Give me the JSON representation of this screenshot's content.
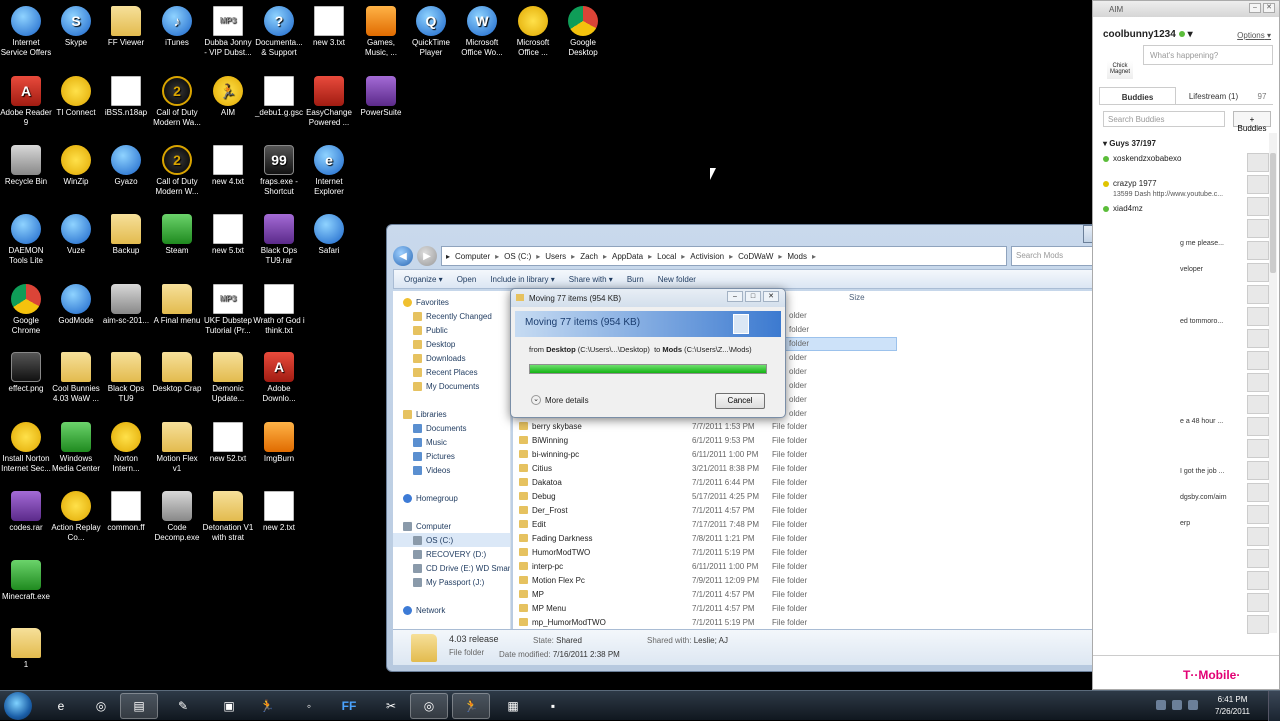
{
  "desktop": {
    "icons": [
      {
        "label": "Internet Service Offers",
        "icon": "globe-icon",
        "style": "blue"
      },
      {
        "label": "Skype",
        "icon": "skype-icon",
        "style": "blue",
        "glyph": "S"
      },
      {
        "label": "FF Viewer",
        "icon": "folder-icon",
        "style": "folder"
      },
      {
        "label": "iTunes",
        "icon": "itunes-icon",
        "style": "blue",
        "glyph": "♪"
      },
      {
        "label": "Dubba Jonny - VIP Dubst...",
        "icon": "mp3-icon",
        "style": "doc",
        "glyph": "MP3"
      },
      {
        "label": "Documenta... & Support",
        "icon": "help-icon",
        "style": "blue",
        "glyph": "?"
      },
      {
        "label": "new 3.txt",
        "icon": "text-file-icon",
        "style": "doc"
      },
      {
        "label": "Games, Music, ...",
        "icon": "games-icon",
        "style": "orange"
      },
      {
        "label": "QuickTime Player",
        "icon": "quicktime-icon",
        "style": "blue",
        "glyph": "Q"
      },
      {
        "label": "Microsoft Office Wo...",
        "icon": "word-icon",
        "style": "blue",
        "glyph": "W"
      },
      {
        "label": "Microsoft Office ...",
        "icon": "office-icon",
        "style": "yellow"
      },
      {
        "label": "Google Desktop",
        "icon": "google-desktop-icon",
        "style": "chrome"
      },
      {
        "label": "Adobe Reader 9",
        "icon": "adobe-reader-icon",
        "style": "red",
        "glyph": "A"
      },
      {
        "label": "TI Connect",
        "icon": "ti-connect-icon",
        "style": "yellow"
      },
      {
        "label": "iBSS.n18ap",
        "icon": "file-icon",
        "style": "doc"
      },
      {
        "label": "Call of Duty Modern Wa...",
        "icon": "cod-icon",
        "style": "cod",
        "glyph": "2"
      },
      {
        "label": "AIM",
        "icon": "aim-icon",
        "style": "yellow",
        "glyph": "🏃"
      },
      {
        "label": "_debu1.g.gsc",
        "icon": "file-icon",
        "style": "doc"
      },
      {
        "label": "EasyChange Powered ...",
        "icon": "easychange-icon",
        "style": "red"
      },
      {
        "label": "PowerSuite",
        "icon": "powersuite-icon",
        "style": "purple"
      },
      {
        "label": "Recycle Bin",
        "icon": "recycle-bin-icon",
        "style": "gray"
      },
      {
        "label": "WinZip",
        "icon": "winzip-icon",
        "style": "yellow"
      },
      {
        "label": "Gyazo",
        "icon": "gyazo-icon",
        "style": "blue"
      },
      {
        "label": "Call of Duty Modern W...",
        "icon": "cod-icon",
        "style": "cod",
        "glyph": "2"
      },
      {
        "label": "new 4.txt",
        "icon": "text-file-icon",
        "style": "doc"
      },
      {
        "label": "fraps.exe - Shortcut",
        "icon": "fraps-icon",
        "style": "dark",
        "glyph": "99"
      },
      {
        "label": "Internet Explorer",
        "icon": "ie-icon",
        "style": "blue",
        "glyph": "e"
      },
      {
        "label": "DAEMON Tools Lite",
        "icon": "daemon-tools-icon",
        "style": "blue"
      },
      {
        "label": "Vuze",
        "icon": "vuze-icon",
        "style": "blue"
      },
      {
        "label": "Backup",
        "icon": "folder-icon",
        "style": "folder"
      },
      {
        "label": "Steam",
        "icon": "steam-icon",
        "style": "green"
      },
      {
        "label": "new 5.txt",
        "icon": "text-file-icon",
        "style": "doc"
      },
      {
        "label": "Black Ops TU9.rar",
        "icon": "rar-icon",
        "style": "purple"
      },
      {
        "label": "Safari",
        "icon": "safari-icon",
        "style": "blue"
      },
      {
        "label": "Google Chrome",
        "icon": "chrome-icon",
        "style": "chrome"
      },
      {
        "label": "GodMode",
        "icon": "godmode-icon",
        "style": "blue"
      },
      {
        "label": "aim-sc-201...",
        "icon": "image-file-icon",
        "style": "gray"
      },
      {
        "label": "A Final menu",
        "icon": "folder-icon",
        "style": "folder"
      },
      {
        "label": "UKF Dubstep Tutorial (Pr...",
        "icon": "mp3-icon",
        "style": "doc",
        "glyph": "MP3"
      },
      {
        "label": "Wrath of God i think.txt",
        "icon": "text-file-icon",
        "style": "doc"
      },
      {
        "label": "effect.png",
        "icon": "image-file-icon",
        "style": "dark"
      },
      {
        "label": "Cool Bunnies 4.03 WaW ...",
        "icon": "folder-icon",
        "style": "folder"
      },
      {
        "label": "Black Ops TU9",
        "icon": "folder-icon",
        "style": "folder"
      },
      {
        "label": "Desktop Crap",
        "icon": "folder-icon",
        "style": "folder"
      },
      {
        "label": "Demonic Update...",
        "icon": "folder-icon",
        "style": "folder"
      },
      {
        "label": "Adobe Downlo...",
        "icon": "adobe-icon",
        "style": "red",
        "glyph": "A"
      },
      {
        "label": "Install Norton Internet Sec...",
        "icon": "norton-icon",
        "style": "yellow"
      },
      {
        "label": "Windows Media Center",
        "icon": "media-center-icon",
        "style": "green"
      },
      {
        "label": "Norton Intern...",
        "icon": "norton-icon",
        "style": "yellow"
      },
      {
        "label": "Motion Flex v1",
        "icon": "folder-icon",
        "style": "folder"
      },
      {
        "label": "new 52.txt",
        "icon": "text-file-icon",
        "style": "doc"
      },
      {
        "label": "ImgBurn",
        "icon": "imgburn-icon",
        "style": "orange"
      },
      {
        "label": "codes.rar",
        "icon": "rar-icon",
        "style": "purple"
      },
      {
        "label": "Action Replay Co...",
        "icon": "action-replay-icon",
        "style": "yellow"
      },
      {
        "label": "common.ff",
        "icon": "file-icon",
        "style": "doc"
      },
      {
        "label": "Code Decomp.exe",
        "icon": "exe-icon",
        "style": "gray"
      },
      {
        "label": "Detonation V1 with strat",
        "icon": "folder-icon",
        "style": "folder"
      },
      {
        "label": "new 2.txt",
        "icon": "text-file-icon",
        "style": "doc"
      },
      {
        "label": "Minecraft.exe",
        "icon": "minecraft-icon",
        "style": "green"
      },
      {
        "label": "1",
        "icon": "folder-icon",
        "style": "folder"
      }
    ]
  },
  "explorer": {
    "breadcrumb": [
      "Computer",
      "OS (C:)",
      "Users",
      "Zach",
      "AppData",
      "Local",
      "Activision",
      "CoDWaW",
      "Mods"
    ],
    "search_placeholder": "Search Mods",
    "toolbar": {
      "organize": "Organize ▾",
      "open": "Open",
      "include": "Include in library ▾",
      "share": "Share with ▾",
      "burn": "Burn",
      "new_folder": "New folder"
    },
    "column_size": "Size",
    "nav": {
      "favorites": "Favorites",
      "fav_items": [
        "Recently Changed",
        "Public",
        "Desktop",
        "Downloads",
        "Recent Places",
        "My Documents"
      ],
      "libraries": "Libraries",
      "lib_items": [
        "Documents",
        "Music",
        "Pictures",
        "Videos"
      ],
      "homegroup": "Homegroup",
      "computer": "Computer",
      "computer_items": [
        "OS (C:)",
        "RECOVERY (D:)",
        "CD Drive (E:) WD Smar",
        "My Passport (J:)"
      ],
      "network": "Network"
    },
    "hidden_type_labels": [
      "older",
      "folder",
      "folder",
      "older",
      "older",
      "older",
      "older",
      "older"
    ],
    "files": [
      {
        "name": "berry skybase",
        "date": "7/7/2011 1:53 PM",
        "type": "File folder"
      },
      {
        "name": "BiWinning",
        "date": "6/1/2011 9:53 PM",
        "type": "File folder"
      },
      {
        "name": "bi-winning-pc",
        "date": "6/11/2011 1:00 PM",
        "type": "File folder"
      },
      {
        "name": "Citius",
        "date": "3/21/2011 8:38 PM",
        "type": "File folder"
      },
      {
        "name": "Dakatoa",
        "date": "7/1/2011 6:44 PM",
        "type": "File folder"
      },
      {
        "name": "Debug",
        "date": "5/17/2011 4:25 PM",
        "type": "File folder"
      },
      {
        "name": "Der_Frost",
        "date": "7/1/2011 4:57 PM",
        "type": "File folder"
      },
      {
        "name": "Edit",
        "date": "7/17/2011 7:48 PM",
        "type": "File folder"
      },
      {
        "name": "Fading Darkness",
        "date": "7/8/2011 1:21 PM",
        "type": "File folder"
      },
      {
        "name": "HumorModTWO",
        "date": "7/1/2011 5:19 PM",
        "type": "File folder"
      },
      {
        "name": "interp-pc",
        "date": "6/11/2011 1:00 PM",
        "type": "File folder"
      },
      {
        "name": "Motion Flex Pc",
        "date": "7/9/2011 12:09 PM",
        "type": "File folder"
      },
      {
        "name": "MP",
        "date": "7/1/2011 4:57 PM",
        "type": "File folder"
      },
      {
        "name": "MP Menu",
        "date": "7/1/2011 4:57 PM",
        "type": "File folder"
      },
      {
        "name": "mp_HumorModTWO",
        "date": "7/1/2011 5:19 PM",
        "type": "File folder"
      }
    ],
    "details": {
      "name": "4.03 release",
      "type": "File folder",
      "state_label": "State:",
      "state": "Shared",
      "shared_label": "Shared with:",
      "shared": "Leslie; AJ",
      "modified_label": "Date modified:",
      "modified": "7/16/2011 2:38 PM"
    }
  },
  "dialog": {
    "title": "Moving 77 items (954 KB)",
    "heading": "Moving 77 items (954 KB)",
    "from_word": "from",
    "from_bold": "Desktop",
    "from_path": "(C:\\Users\\...\\Desktop)",
    "to_word": "to",
    "to_bold": "Mods",
    "to_path": "(C:\\Users\\Z...\\Mods)",
    "progress": 1.0,
    "more_details": "More details",
    "cancel": "Cancel"
  },
  "aim": {
    "title": "AIM",
    "username": "coolbunny1234",
    "options": "Options",
    "avatar_caption": "Chick Magnet",
    "status_placeholder": "What's happening?",
    "tabs": [
      "Buddies",
      "Lifestream (1)"
    ],
    "tab_count": "97",
    "search_placeholder": "Search Buddies",
    "add_buddies": "+ Buddies",
    "group": "Guys 37/197",
    "buddies": [
      {
        "name": "xoskendzxobabexo",
        "status_color": "#5bbd3a"
      },
      {
        "name": "crazyp 1977",
        "status_color": "#e0c400",
        "sub": "13599 Dash http://www.youtube.c..."
      },
      {
        "name": "xiad4mz",
        "status_color": "#5bbd3a"
      }
    ],
    "snippets": [
      "g me please...",
      "veloper",
      "ed tommoro...",
      "e a 48 hour ...",
      "I got the job ...",
      "dgsby.com/aim",
      "erp"
    ],
    "ad": "T··Mobile·"
  },
  "taskbar": {
    "time": "6:41 PM",
    "date": "7/26/2011"
  }
}
